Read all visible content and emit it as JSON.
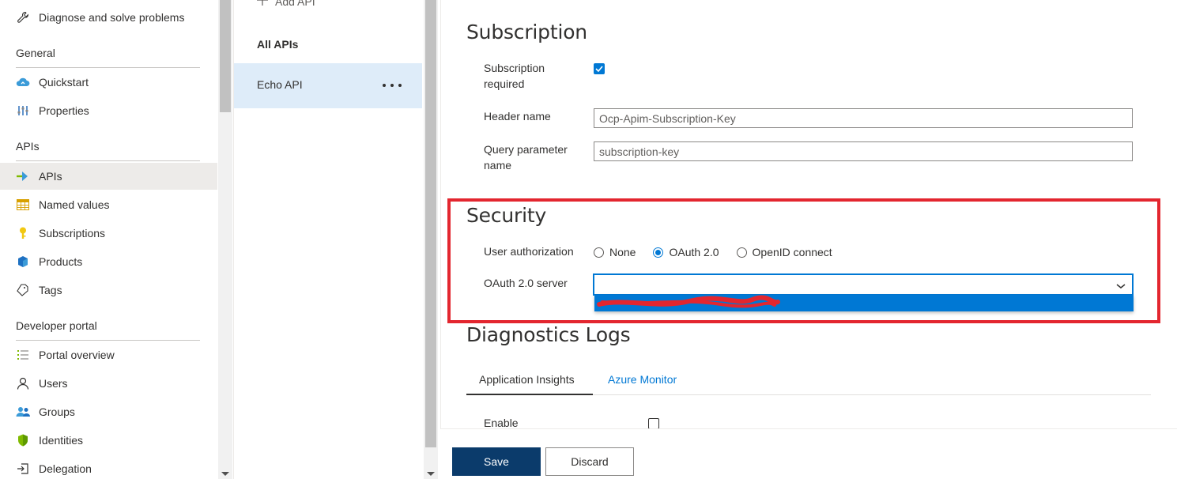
{
  "leftnav": {
    "top_item": {
      "label": "Diagnose and solve problems",
      "icon": "wrench-icon"
    },
    "sections": [
      {
        "title": "General",
        "items": [
          {
            "label": "Quickstart",
            "icon": "cloud-icon"
          },
          {
            "label": "Properties",
            "icon": "sliders-icon"
          }
        ]
      },
      {
        "title": "APIs",
        "items": [
          {
            "label": "APIs",
            "icon": "api-arrow-icon",
            "selected": true
          },
          {
            "label": "Named values",
            "icon": "table-icon"
          },
          {
            "label": "Subscriptions",
            "icon": "key-icon"
          },
          {
            "label": "Products",
            "icon": "cube-icon"
          },
          {
            "label": "Tags",
            "icon": "tag-icon"
          }
        ]
      },
      {
        "title": "Developer portal",
        "items": [
          {
            "label": "Portal overview",
            "icon": "list-icon"
          },
          {
            "label": "Users",
            "icon": "user-icon"
          },
          {
            "label": "Groups",
            "icon": "group-icon"
          },
          {
            "label": "Identities",
            "icon": "shield-icon"
          },
          {
            "label": "Delegation",
            "icon": "delegation-icon"
          }
        ]
      }
    ]
  },
  "apilist": {
    "add_label": "Add API",
    "all_apis_label": "All APIs",
    "selected_api": "Echo API"
  },
  "subscription": {
    "heading": "Subscription",
    "required_label": "Subscription required",
    "required_checked": true,
    "header_name_label": "Header name",
    "header_name_value": "Ocp-Apim-Subscription-Key",
    "query_param_label": "Query parameter name",
    "query_param_value": "subscription-key"
  },
  "security": {
    "heading": "Security",
    "user_auth_label": "User authorization",
    "options": [
      "None",
      "OAuth 2.0",
      "OpenID connect"
    ],
    "selected_option": "OAuth 2.0",
    "oauth_server_label": "OAuth 2.0 server",
    "oauth_server_value": ""
  },
  "diagnostics": {
    "heading": "Diagnostics Logs",
    "tabs": [
      "Application Insights",
      "Azure Monitor"
    ],
    "active_tab": "Application Insights",
    "enable_label": "Enable",
    "enable_checked": false
  },
  "footer": {
    "save_label": "Save",
    "discard_label": "Discard"
  },
  "colors": {
    "accent": "#0078d4",
    "save_button": "#0b3b6b",
    "highlight_border": "#e3262f",
    "selected_row": "#deecf9"
  }
}
